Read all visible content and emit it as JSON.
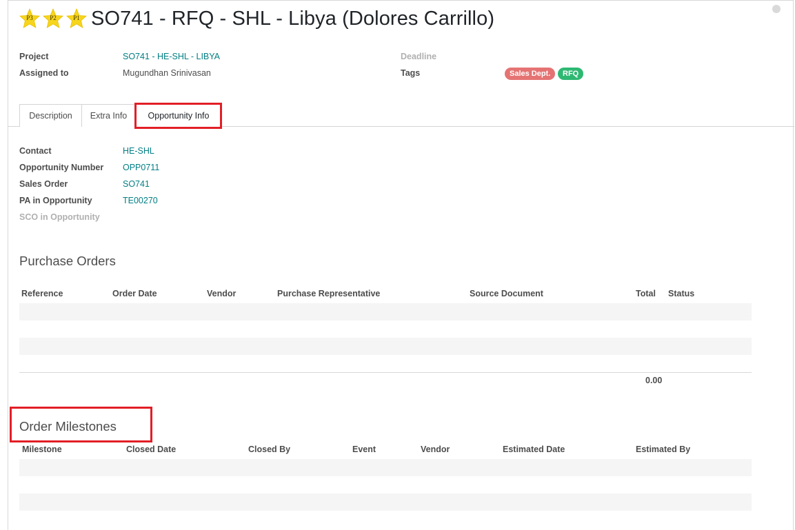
{
  "record": {
    "priority_stars": [
      "P3",
      "P2",
      "P1"
    ],
    "title": "SO741 - RFQ - SHL - Libya (Dolores Carrillo)"
  },
  "fields": {
    "project_label": "Project",
    "project_value": "SO741 - HE-SHL - LIBYA",
    "assigned_label": "Assigned to",
    "assigned_value": "Mugundhan Srinivasan",
    "deadline_label": "Deadline",
    "tags_label": "Tags",
    "tags": [
      "Sales Dept.",
      "RFQ"
    ]
  },
  "tabs": [
    "Description",
    "Extra Info",
    "Opportunity Info"
  ],
  "opportunity": {
    "contact_label": "Contact",
    "contact_value": "HE-SHL",
    "opp_number_label": "Opportunity Number",
    "opp_number_value": "OPP0711",
    "sales_order_label": "Sales Order",
    "sales_order_value": "SO741",
    "pa_label": "PA in Opportunity",
    "pa_value": "TE00270",
    "sco_label": "SCO in Opportunity"
  },
  "purchase_orders": {
    "title": "Purchase Orders",
    "columns": [
      "Reference",
      "Order Date",
      "Vendor",
      "Purchase Representative",
      "Source Document",
      "Total",
      "Status"
    ],
    "total": "0.00"
  },
  "milestones": {
    "title": "Order Milestones",
    "columns": [
      "Milestone",
      "Closed Date",
      "Closed By",
      "Event",
      "Vendor",
      "Estimated Date",
      "Estimated By"
    ]
  },
  "colors": {
    "link": "#017e84",
    "tag_sales": "#e57373",
    "tag_rfq": "#2eb872",
    "highlight": "#e21e26",
    "star": "#f7d51d"
  }
}
